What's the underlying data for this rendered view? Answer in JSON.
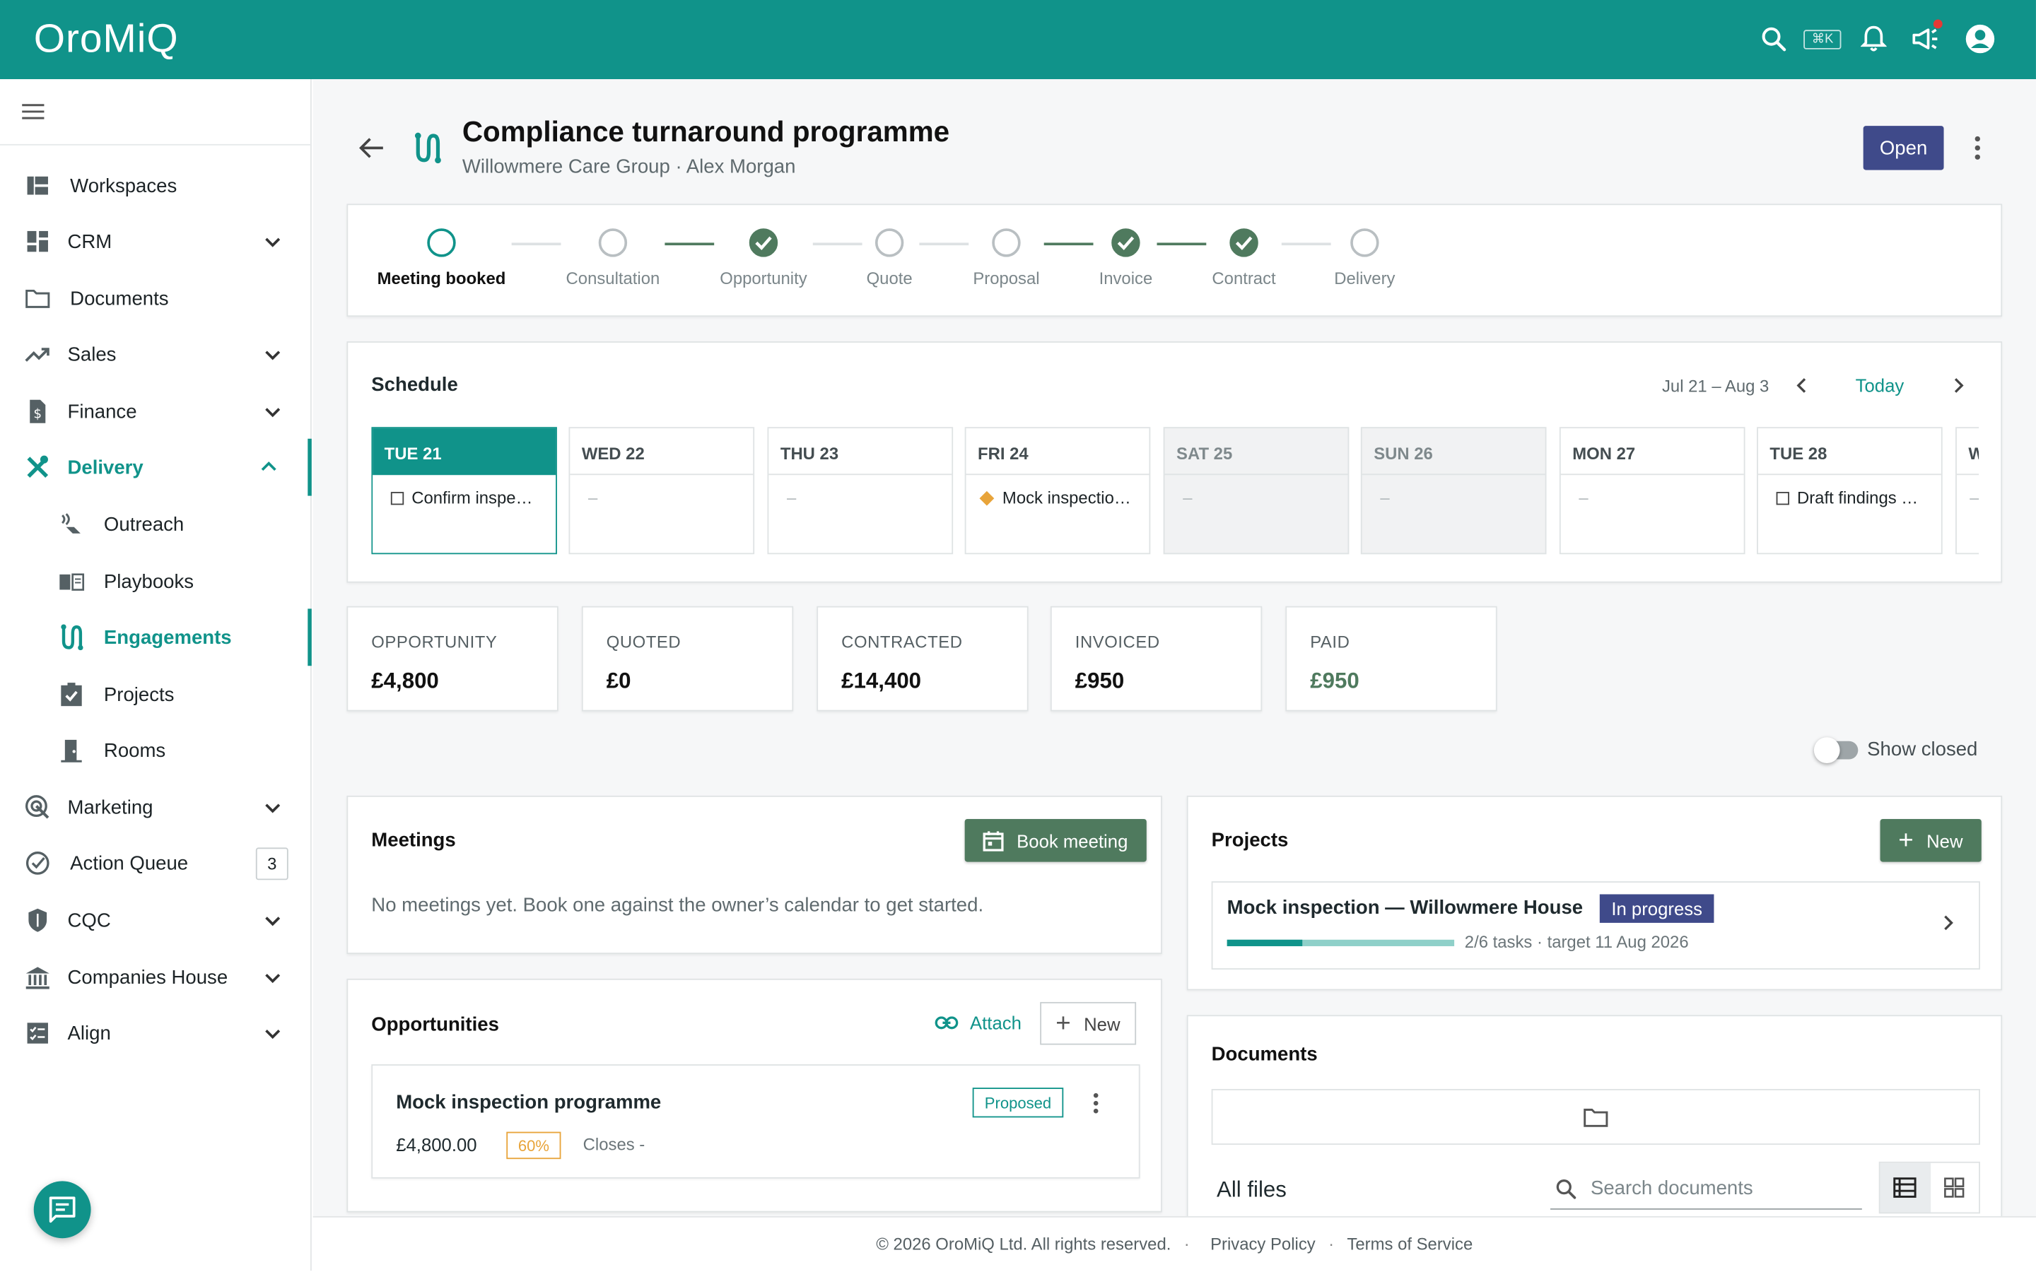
{
  "app": {
    "logo": "OroMiQ",
    "shortcut": "⌘K",
    "accent": "#10938a"
  },
  "sidebar": {
    "items": [
      {
        "label": "Workspaces",
        "icon": "workspaces-icon"
      },
      {
        "label": "CRM",
        "icon": "crm-icon"
      },
      {
        "label": "Documents",
        "icon": "folder-icon"
      },
      {
        "label": "Sales",
        "icon": "trending-up-icon"
      },
      {
        "label": "Finance",
        "icon": "finance-icon"
      },
      {
        "label": "Delivery",
        "icon": "tools-icon"
      },
      {
        "label": "Outreach",
        "icon": "outreach-icon"
      },
      {
        "label": "Playbooks",
        "icon": "book-icon"
      },
      {
        "label": "Engagements",
        "icon": "route-icon"
      },
      {
        "label": "Projects",
        "icon": "clipboard-check-icon"
      },
      {
        "label": "Rooms",
        "icon": "door-icon"
      },
      {
        "label": "Marketing",
        "icon": "target-icon"
      },
      {
        "label": "Action Queue",
        "icon": "check-circle-icon",
        "count": "3"
      },
      {
        "label": "CQC",
        "icon": "shield-icon"
      },
      {
        "label": "Companies House",
        "icon": "bank-icon"
      },
      {
        "label": "Align",
        "icon": "checklist-icon"
      }
    ]
  },
  "header": {
    "title": "Compliance turnaround programme",
    "subtitle": "Willowmere Care Group · Alex Morgan",
    "status_button": "Open"
  },
  "pipeline": {
    "stages": [
      {
        "label": "Meeting booked",
        "state": "current"
      },
      {
        "label": "Consultation",
        "state": "todo"
      },
      {
        "label": "Opportunity",
        "state": "done"
      },
      {
        "label": "Quote",
        "state": "todo"
      },
      {
        "label": "Proposal",
        "state": "todo"
      },
      {
        "label": "Invoice",
        "state": "done"
      },
      {
        "label": "Contract",
        "state": "done"
      },
      {
        "label": "Delivery",
        "state": "todo"
      }
    ]
  },
  "schedule": {
    "title": "Schedule",
    "range": "Jul 21 – Aug 3",
    "today_label": "Today",
    "days": [
      {
        "label": "TUE 21",
        "item": "Confirm inspe…",
        "kind": "task"
      },
      {
        "label": "WED 22",
        "item": "–",
        "kind": "empty"
      },
      {
        "label": "THU 23",
        "item": "–",
        "kind": "empty"
      },
      {
        "label": "FRI 24",
        "item": "Mock inspectio…",
        "kind": "milestone"
      },
      {
        "label": "SAT 25",
        "item": "–",
        "kind": "empty"
      },
      {
        "label": "SUN 26",
        "item": "–",
        "kind": "empty"
      },
      {
        "label": "MON 27",
        "item": "–",
        "kind": "empty"
      },
      {
        "label": "TUE 28",
        "item": "Draft findings …",
        "kind": "task"
      },
      {
        "label": "W",
        "item": "–",
        "kind": "empty"
      }
    ]
  },
  "metrics": [
    {
      "label": "OPPORTUNITY",
      "value": "£4,800"
    },
    {
      "label": "QUOTED",
      "value": "£0"
    },
    {
      "label": "CONTRACTED",
      "value": "£14,400"
    },
    {
      "label": "INVOICED",
      "value": "£950"
    },
    {
      "label": "PAID",
      "value": "£950"
    }
  ],
  "show_closed": {
    "label": "Show closed",
    "on": false
  },
  "meetings": {
    "title": "Meetings",
    "button": "Book meeting",
    "empty": "No meetings yet. Book one against the owner’s calendar to get started."
  },
  "opportunities": {
    "title": "Opportunities",
    "attach": "Attach",
    "new": "New",
    "item": {
      "name": "Mock inspection programme",
      "status": "Proposed",
      "amount": "£4,800.00",
      "probability": "60%",
      "closes": "Closes -"
    }
  },
  "projects": {
    "title": "Projects",
    "new": "New",
    "item": {
      "name": "Mock inspection — Willowmere House",
      "status": "In progress",
      "meta": "2/6 tasks · target 11 Aug 2026",
      "progress": 0.33
    }
  },
  "documents": {
    "title": "Documents",
    "all_files": "All files",
    "search_placeholder": "Search documents"
  },
  "footer": {
    "copyright": "© 2026 OroMiQ Ltd. All rights reserved.",
    "privacy": "Privacy Policy",
    "terms": "Terms of Service"
  }
}
